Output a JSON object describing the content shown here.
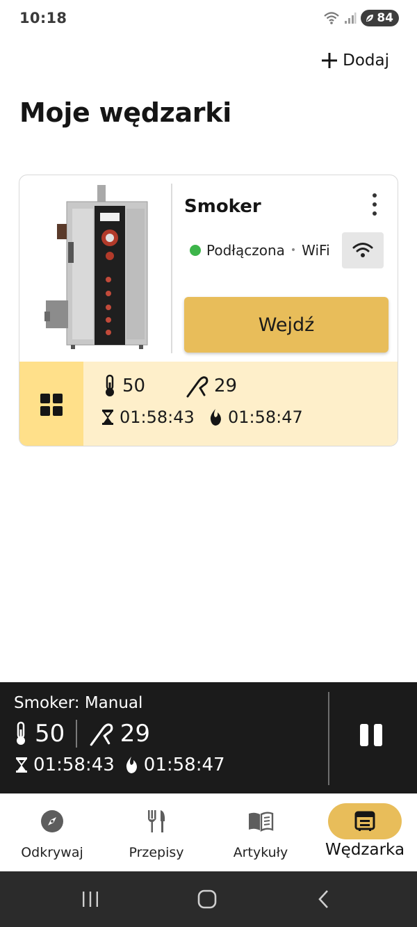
{
  "status_bar": {
    "time": "10:18",
    "battery": "84"
  },
  "header": {
    "add_label": "Dodaj",
    "title": "Moje wędzarki"
  },
  "device": {
    "name": "Smoker",
    "status": "Podłączona",
    "connection": "WiFi",
    "enter_label": "Wejdź",
    "temperature": "50",
    "probe": "29",
    "timer": "01:58:43",
    "burn_time": "01:58:47",
    "colors": {
      "accent": "#e8bd5a",
      "stats_bg": "#feefca",
      "grid_btn_bg": "#ffe08a",
      "online": "#3db54a"
    }
  },
  "now_playing": {
    "title": "Smoker: Manual",
    "temperature": "50",
    "probe": "29",
    "timer": "01:58:43",
    "burn_time": "01:58:47"
  },
  "bottom_nav": {
    "items": [
      {
        "label": "Odkrywaj",
        "icon": "compass-icon"
      },
      {
        "label": "Przepisy",
        "icon": "fork-knife-icon"
      },
      {
        "label": "Artykuły",
        "icon": "book-icon"
      },
      {
        "label": "Wędzarka",
        "icon": "smoker-icon",
        "active": true
      }
    ]
  },
  "system_nav": {
    "icons": [
      "recent-apps-icon",
      "home-icon",
      "back-icon"
    ]
  }
}
